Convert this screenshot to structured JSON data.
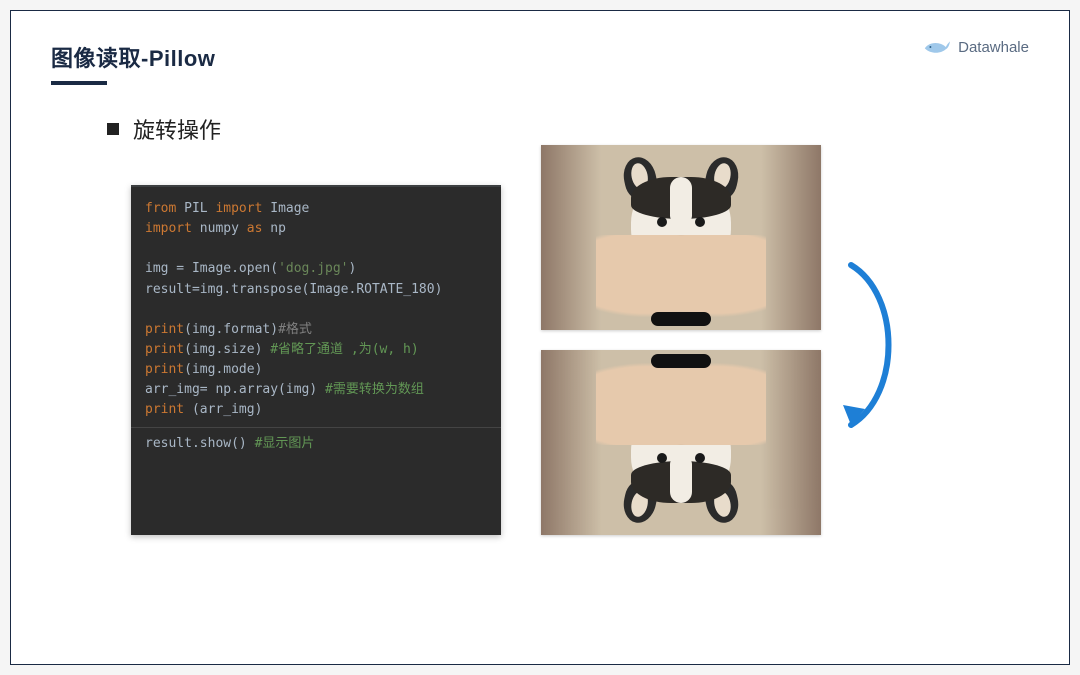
{
  "header": {
    "title": "图像读取-Pillow",
    "brand": "Datawhale"
  },
  "bullet": {
    "label": "旋转操作"
  },
  "code": {
    "l1_kw1": "from",
    "l1_id1": " PIL ",
    "l1_kw2": "import",
    "l1_id2": " Image",
    "l2_kw1": "import",
    "l2_id1": " numpy ",
    "l2_kw2": "as",
    "l2_id2": " np",
    "l3_a": "img = Image.open(",
    "l3_str": "'dog.jpg'",
    "l3_b": ")",
    "l4": "result=img.transpose(Image.ROTATE_180)",
    "l5_a": "print",
    "l5_b": "(img.format)",
    "l5_cm": "#格式",
    "l6_a": "print",
    "l6_b": "(img.size) ",
    "l6_cm": "#省略了通道 ,为(w, h)",
    "l7_a": "print",
    "l7_b": "(img.mode)",
    "l8_a": "arr_img= np.array(img) ",
    "l8_cm": "#需要转换为数组",
    "l9_a": "print ",
    "l9_b": "(arr_img)",
    "l10_a": "result.show() ",
    "l10_cm": "#显示图片"
  },
  "images": {
    "top_alt": "dog original",
    "bottom_alt": "dog rotated 180"
  }
}
